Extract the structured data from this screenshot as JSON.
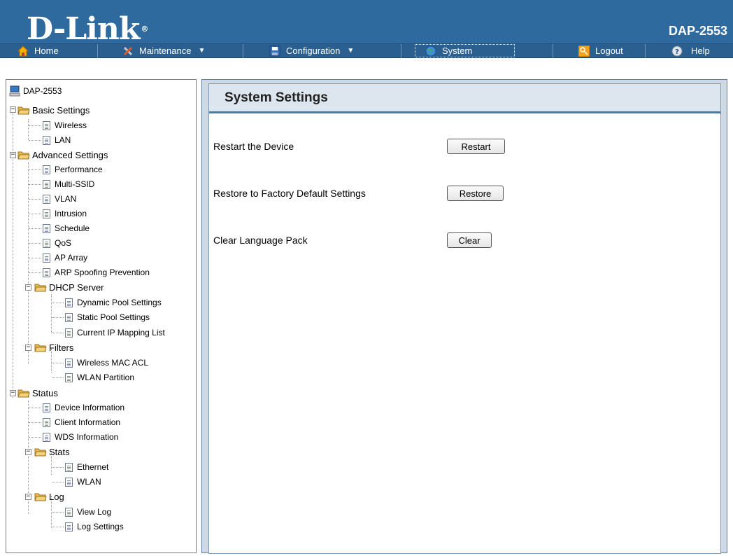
{
  "header": {
    "brand": "D-Link",
    "brand_mark": "®",
    "model": "DAP-2553"
  },
  "nav": {
    "home": "Home",
    "maintenance": "Maintenance",
    "configuration": "Configuration",
    "system": "System",
    "logout": "Logout",
    "help": "Help"
  },
  "tree": {
    "root": "DAP-2553",
    "basic_settings": "Basic Settings",
    "wireless": "Wireless",
    "lan": "LAN",
    "advanced_settings": "Advanced Settings",
    "performance": "Performance",
    "multi_ssid": "Multi-SSID",
    "vlan": "VLAN",
    "intrusion": "Intrusion",
    "schedule": "Schedule",
    "qos": "QoS",
    "ap_array": "AP Array",
    "arp_spoofing": "ARP Spoofing Prevention",
    "dhcp_server": "DHCP Server",
    "dynamic_pool": "Dynamic Pool Settings",
    "static_pool": "Static Pool Settings",
    "ip_mapping": "Current IP Mapping List",
    "filters": "Filters",
    "wireless_mac_acl": "Wireless MAC ACL",
    "wlan_partition": "WLAN Partition",
    "status": "Status",
    "device_info": "Device Information",
    "client_info": "Client Information",
    "wds_info": "WDS Information",
    "stats": "Stats",
    "ethernet": "Ethernet",
    "wlan": "WLAN",
    "log": "Log",
    "view_log": "View Log",
    "log_settings": "Log Settings"
  },
  "main": {
    "title": "System Settings",
    "restart_label": "Restart the Device",
    "restart_btn": "Restart",
    "restore_label": "Restore to Factory Default Settings",
    "restore_btn": "Restore",
    "clear_label": "Clear Language Pack",
    "clear_btn": "Clear"
  },
  "colors": {
    "header_bg": "#2f6a9e",
    "nav_bg": "#2a5f90",
    "title_underline": "#4d7aa3"
  }
}
